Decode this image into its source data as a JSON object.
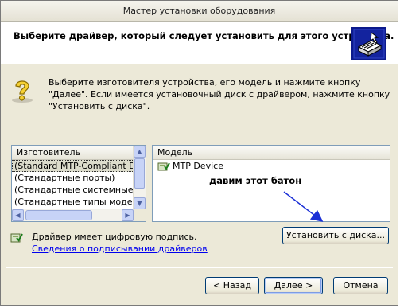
{
  "window": {
    "title": "Мастер установки оборудования"
  },
  "header": {
    "title": "Выберите драйвер, который следует установить для этого устройства.",
    "icon": "hardware-wizard-icon"
  },
  "instructions": {
    "icon": "question-icon",
    "text": "Выберите изготовителя устройства, его модель и нажмите кнопку \"Далее\". Если имеется установочный диск с  драйвером, нажмите кнопку \"Установить с диска\"."
  },
  "manufacturer_list": {
    "header": "Изготовитель",
    "items": [
      {
        "label": "(Standard MTP-Compliant Dev",
        "selected": true
      },
      {
        "label": "(Стандартные порты)",
        "selected": false
      },
      {
        "label": "(Стандартные системные уст",
        "selected": false
      },
      {
        "label": "(Стандартные типы модемов",
        "selected": false
      }
    ]
  },
  "model_list": {
    "header": "Модель",
    "items": [
      {
        "label": "MTP Device",
        "icon": "signed-driver-icon"
      }
    ]
  },
  "annotation": {
    "text": "давим этот батон",
    "arrow_color": "#1a2fd6"
  },
  "have_disk_button": {
    "label": "Установить с диска..."
  },
  "signature": {
    "text": "Драйвер имеет цифровую подпись.",
    "link": "Сведения о подписывании драйверов"
  },
  "buttons": {
    "back": "< Назад",
    "next": "Далее >",
    "cancel": "Отмена"
  },
  "colors": {
    "window_bg": "#ece9d8",
    "link": "#0000ee",
    "selection": "#dcdccc"
  }
}
